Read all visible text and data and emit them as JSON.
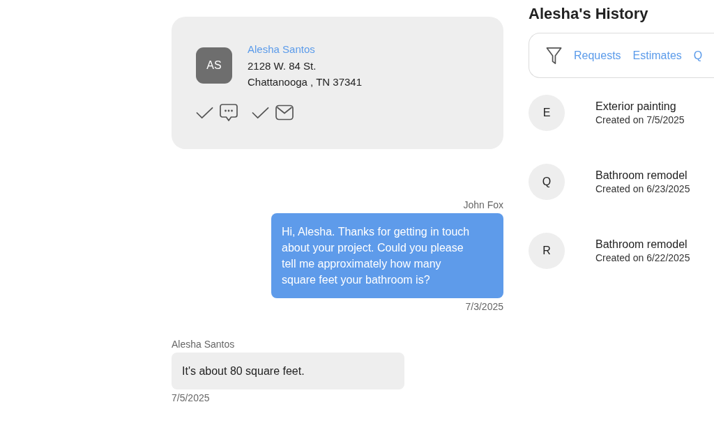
{
  "contact": {
    "initials": "AS",
    "name": "Alesha Santos",
    "address_lines": [
      "2128 W. 84 St.",
      "Chattanooga , TN 37341"
    ],
    "channels": [
      {
        "kind": "sms",
        "checked": true
      },
      {
        "kind": "email",
        "checked": true
      }
    ]
  },
  "messages": [
    {
      "kind": "outgoing",
      "sender": "John Fox",
      "text": "Hi, Alesha. Thanks for getting in touch about your project. Could you please tell me approximately how many square feet your bathroom is?",
      "date": "7/3/2025"
    },
    {
      "kind": "incoming",
      "sender": "Alesha Santos",
      "text": "It's about 80 square feet.",
      "date": "7/5/2025"
    }
  ],
  "history": {
    "title": "Alesha's History",
    "filters": [
      "Requests",
      "Estimates",
      "Q"
    ],
    "items": [
      {
        "initial": "E",
        "title": "Exterior painting",
        "created": "Created on 7/5/2025"
      },
      {
        "initial": "Q",
        "title": "Bathroom remodel",
        "created": "Created on 6/23/2025"
      },
      {
        "initial": "R",
        "title": "Bathroom remodel",
        "created": "Created on 6/22/2025"
      }
    ]
  }
}
